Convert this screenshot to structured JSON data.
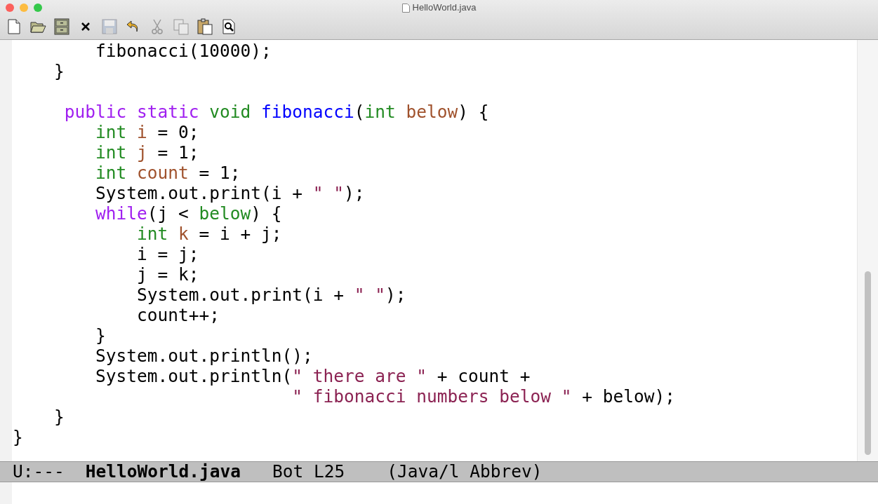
{
  "window": {
    "title": "HelloWorld.java"
  },
  "toolbar": [
    {
      "kind": "new",
      "disabled": false
    },
    {
      "kind": "open",
      "disabled": false
    },
    {
      "kind": "cabinet",
      "disabled": false
    },
    {
      "kind": "close",
      "disabled": false
    },
    {
      "kind": "save",
      "disabled": true
    },
    {
      "kind": "undo",
      "disabled": false
    },
    {
      "kind": "cut",
      "disabled": true
    },
    {
      "kind": "copy",
      "disabled": true
    },
    {
      "kind": "paste",
      "disabled": false
    },
    {
      "kind": "search",
      "disabled": false
    }
  ],
  "editor": {
    "lines": [
      {
        "kind": "code",
        "tokens": [
          {
            "text": "        fibonacci(10000);",
            "kind": "plain"
          }
        ]
      },
      {
        "kind": "code",
        "tokens": [
          {
            "text": "    }",
            "kind": "plain"
          }
        ]
      },
      {
        "kind": "blank"
      },
      {
        "kind": "code",
        "tokens": [
          {
            "text": "     public static ",
            "kind": "keyword"
          },
          {
            "text": "void ",
            "kind": "type"
          },
          {
            "text": "fibonacci",
            "kind": "function"
          },
          {
            "text": "(",
            "kind": "plain"
          },
          {
            "text": "int ",
            "kind": "type"
          },
          {
            "text": "below",
            "kind": "variable"
          },
          {
            "text": ") {",
            "kind": "plain"
          }
        ]
      },
      {
        "kind": "code",
        "tokens": [
          {
            "text": "        int ",
            "kind": "type"
          },
          {
            "text": "i",
            "kind": "variable"
          },
          {
            "text": " = 0;",
            "kind": "plain"
          }
        ]
      },
      {
        "kind": "code",
        "tokens": [
          {
            "text": "        int ",
            "kind": "type"
          },
          {
            "text": "j",
            "kind": "variable"
          },
          {
            "text": " = 1;",
            "kind": "plain"
          }
        ]
      },
      {
        "kind": "code",
        "tokens": [
          {
            "text": "        int ",
            "kind": "type"
          },
          {
            "text": "count",
            "kind": "variable"
          },
          {
            "text": " = 1;",
            "kind": "plain"
          }
        ]
      },
      {
        "kind": "code",
        "tokens": [
          {
            "text": "        System.out.print(i + ",
            "kind": "plain"
          },
          {
            "text": "\" \"",
            "kind": "string"
          },
          {
            "text": ");",
            "kind": "plain"
          }
        ]
      },
      {
        "kind": "code",
        "tokens": [
          {
            "text": "        while",
            "kind": "keyword"
          },
          {
            "text": "(j < ",
            "kind": "plain"
          },
          {
            "text": "below",
            "kind": "type"
          },
          {
            "text": ") {",
            "kind": "plain"
          }
        ]
      },
      {
        "kind": "code",
        "tokens": [
          {
            "text": "            int ",
            "kind": "type"
          },
          {
            "text": "k",
            "kind": "variable"
          },
          {
            "text": " = i + j;",
            "kind": "plain"
          }
        ]
      },
      {
        "kind": "code",
        "tokens": [
          {
            "text": "            i = j;",
            "kind": "plain"
          }
        ]
      },
      {
        "kind": "code",
        "tokens": [
          {
            "text": "            j = k;",
            "kind": "plain"
          }
        ]
      },
      {
        "kind": "code",
        "tokens": [
          {
            "text": "            System.out.print(i + ",
            "kind": "plain"
          },
          {
            "text": "\" \"",
            "kind": "string"
          },
          {
            "text": ");",
            "kind": "plain"
          }
        ]
      },
      {
        "kind": "code",
        "tokens": [
          {
            "text": "            count++;",
            "kind": "plain"
          }
        ]
      },
      {
        "kind": "code",
        "tokens": [
          {
            "text": "        }",
            "kind": "plain"
          }
        ]
      },
      {
        "kind": "code",
        "tokens": [
          {
            "text": "        System.out.println();",
            "kind": "plain"
          }
        ]
      },
      {
        "kind": "code",
        "tokens": [
          {
            "text": "        System.out.println(",
            "kind": "plain"
          },
          {
            "text": "\" there are \"",
            "kind": "string"
          },
          {
            "text": " + count +",
            "kind": "plain"
          }
        ]
      },
      {
        "kind": "code",
        "tokens": [
          {
            "text": "                           \" fibonacci numbers below \"",
            "kind": "string"
          },
          {
            "text": " + below);",
            "kind": "plain"
          }
        ]
      },
      {
        "kind": "code",
        "tokens": [
          {
            "text": "    }",
            "kind": "plain"
          }
        ]
      },
      {
        "kind": "code",
        "tokens": [
          {
            "text": "}",
            "kind": "plain"
          }
        ]
      }
    ]
  },
  "mode_line": {
    "status": "U:---",
    "buffer": "HelloWorld.java",
    "position": "Bot L25",
    "mode": "(Java/l Abbrev)"
  }
}
